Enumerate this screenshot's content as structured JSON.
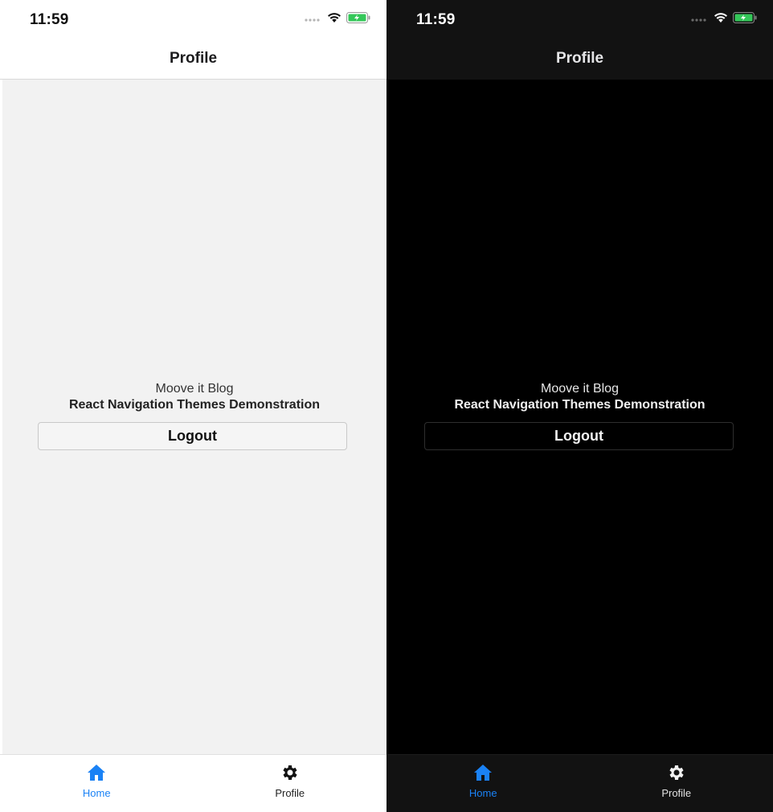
{
  "light": {
    "status": {
      "time": "11:59"
    },
    "header": {
      "title": "Profile"
    },
    "main": {
      "blog_name": "Moove it Blog",
      "subtitle": "React Navigation Themes Demonstration",
      "logout_label": "Logout"
    },
    "tabs": [
      {
        "label": "Home",
        "icon": "home-icon",
        "active": true
      },
      {
        "label": "Profile",
        "icon": "gear-icon",
        "active": false
      }
    ]
  },
  "dark": {
    "status": {
      "time": "11:59"
    },
    "header": {
      "title": "Profile"
    },
    "main": {
      "blog_name": "Moove it Blog",
      "subtitle": "React Navigation Themes Demonstration",
      "logout_label": "Logout"
    },
    "tabs": [
      {
        "label": "Home",
        "icon": "home-icon",
        "active": true
      },
      {
        "label": "Profile",
        "icon": "gear-icon",
        "active": false
      }
    ]
  },
  "colors": {
    "accent": "#1a82f5",
    "light_bg": "#f2f2f2",
    "dark_bg": "#000000",
    "battery": "#34c759"
  }
}
